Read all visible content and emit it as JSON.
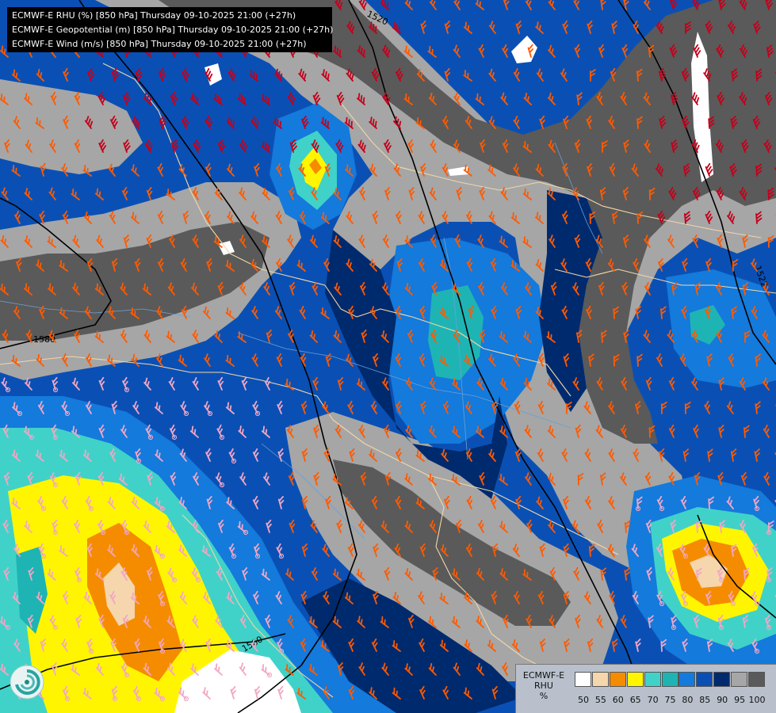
{
  "header": {
    "lines": [
      "ECMWF-E RHU (%) [850 hPa] Thursday 09-10-2025 21:00 (+27h)",
      "ECMWF-E Geopotential (m) [850 hPa] Thursday 09-10-2025 21:00 (+27h)",
      "ECMWF-E Wind (m/s) [850 hPa] Thursday 09-10-2025 21:00 (+27h)"
    ]
  },
  "legend": {
    "title": [
      "ECMWF-E",
      "RHU",
      "%"
    ],
    "classes": [
      {
        "color": "#ffffff",
        "label": "50"
      },
      {
        "color": "#f5d6ad",
        "label": "55"
      },
      {
        "color": "#f58c00",
        "label": "60"
      },
      {
        "color": "#fff500",
        "label": "65"
      },
      {
        "color": "#40d2c8",
        "label": "70"
      },
      {
        "color": "#1fb4b4",
        "label": "75"
      },
      {
        "color": "#147adc",
        "label": "80"
      },
      {
        "color": "#0a50b4",
        "label": "85"
      },
      {
        "color": "#002a6e",
        "label": "90"
      },
      {
        "color": "#a6a6a6",
        "label": "95"
      },
      {
        "color": "#5a5a5a",
        "label": "100"
      }
    ]
  },
  "contours": [
    {
      "label": "1520"
    },
    {
      "label": "1580"
    },
    {
      "label": "1560"
    },
    {
      "label": "1522"
    }
  ],
  "logo": {
    "icon": "ecmwf-swirl-icon"
  }
}
